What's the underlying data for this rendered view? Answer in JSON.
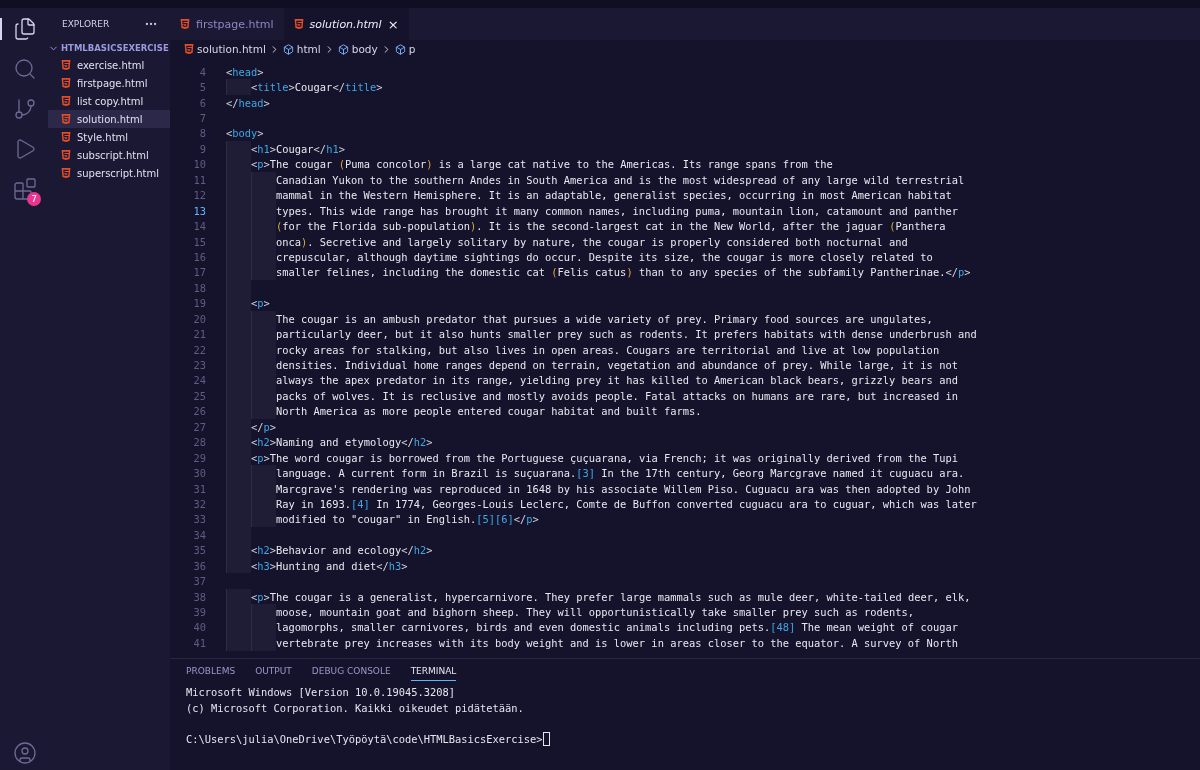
{
  "activity_bar": {
    "items": [
      {
        "kind": "files",
        "selected": true
      },
      {
        "kind": "search",
        "selected": false
      },
      {
        "kind": "source-control",
        "selected": false
      },
      {
        "kind": "run",
        "selected": false
      },
      {
        "kind": "extensions",
        "selected": false,
        "badge": "7"
      }
    ],
    "account": {
      "kind": "account"
    }
  },
  "sidebar": {
    "title": "EXPLORER",
    "folder": {
      "name": "HTMLBASICSEXERCISE",
      "expanded": true,
      "files": [
        {
          "name": "exercise.html",
          "selected": false
        },
        {
          "name": "firstpage.html",
          "selected": false
        },
        {
          "name": "list copy.html",
          "selected": false
        },
        {
          "name": "solution.html",
          "selected": true
        },
        {
          "name": "Style.html",
          "selected": false
        },
        {
          "name": "subscript.html",
          "selected": false
        },
        {
          "name": "superscript.html",
          "selected": false
        }
      ]
    }
  },
  "tabs": [
    {
      "label": "firstpage.html",
      "selected": false
    },
    {
      "label": "solution.html",
      "selected": true,
      "close": "×"
    }
  ],
  "breadcrumbs": [
    {
      "label": "solution.html",
      "kind": "file"
    },
    {
      "label": "html",
      "kind": "element"
    },
    {
      "label": "body",
      "kind": "element"
    },
    {
      "label": "p",
      "kind": "element"
    }
  ],
  "editor": {
    "lines": [
      {
        "num": "4",
        "current": false,
        "tokens": [
          {
            "kind": "punct",
            "text": "<"
          },
          {
            "kind": "tag",
            "text": "head"
          },
          {
            "kind": "punct",
            "text": ">"
          }
        ]
      },
      {
        "num": "5",
        "current": false,
        "tokens": [
          {
            "kind": "indent"
          },
          {
            "kind": "punct",
            "text": "<"
          },
          {
            "kind": "tag",
            "text": "title"
          },
          {
            "kind": "punct",
            "text": ">"
          },
          {
            "kind": "text",
            "text": "Cougar"
          },
          {
            "kind": "punct",
            "text": "</"
          },
          {
            "kind": "tag",
            "text": "title"
          },
          {
            "kind": "punct",
            "text": ">"
          }
        ]
      },
      {
        "num": "6",
        "current": false,
        "tokens": [
          {
            "kind": "punct",
            "text": "</"
          },
          {
            "kind": "tag",
            "text": "head"
          },
          {
            "kind": "punct",
            "text": ">"
          }
        ]
      },
      {
        "num": "7",
        "current": false
      },
      {
        "num": "8",
        "current": false,
        "tokens": [
          {
            "kind": "punct",
            "text": "<"
          },
          {
            "kind": "tag",
            "text": "body"
          },
          {
            "kind": "punct",
            "text": ">"
          }
        ]
      },
      {
        "num": "9",
        "current": false,
        "tokens": [
          {
            "kind": "indent"
          },
          {
            "kind": "punct",
            "text": "<"
          },
          {
            "kind": "tag",
            "text": "h1"
          },
          {
            "kind": "punct",
            "text": ">"
          },
          {
            "kind": "text",
            "text": "Cougar"
          },
          {
            "kind": "punct",
            "text": "</"
          },
          {
            "kind": "tag",
            "text": "h1"
          },
          {
            "kind": "punct",
            "text": ">"
          }
        ]
      },
      {
        "num": "10",
        "current": false,
        "tokens": [
          {
            "kind": "indent"
          },
          {
            "kind": "punct",
            "text": "<"
          },
          {
            "kind": "tag",
            "text": "p"
          },
          {
            "kind": "punct",
            "text": ">"
          },
          {
            "kind": "text",
            "text": "The cougar "
          },
          {
            "kind": "paren",
            "text": "("
          },
          {
            "kind": "text",
            "text": "Puma concolor"
          },
          {
            "kind": "paren",
            "text": ")"
          },
          {
            "kind": "text",
            "text": " is a large cat native to the Americas. Its range spans from the"
          }
        ]
      },
      {
        "num": "11",
        "current": false,
        "tokens": [
          {
            "kind": "indent"
          },
          {
            "kind": "indent"
          },
          {
            "kind": "text",
            "text": "Canadian Yukon to the southern Andes in South America and is the most widespread of any large wild terrestrial"
          }
        ]
      },
      {
        "num": "12",
        "current": false,
        "tokens": [
          {
            "kind": "indent"
          },
          {
            "kind": "indent"
          },
          {
            "kind": "text",
            "text": "mammal in the Western Hemisphere. It is an adaptable, generalist species, occurring in most American habitat"
          }
        ]
      },
      {
        "num": "13",
        "current": true,
        "tokens": [
          {
            "kind": "indent"
          },
          {
            "kind": "indent"
          },
          {
            "kind": "text",
            "text": "types. This wide range has brought it many common names, including puma, mountain lion, catamount and panther"
          }
        ]
      },
      {
        "num": "14",
        "current": false,
        "tokens": [
          {
            "kind": "indent"
          },
          {
            "kind": "indent"
          },
          {
            "kind": "paren",
            "text": "("
          },
          {
            "kind": "text",
            "text": "for the Florida sub-population"
          },
          {
            "kind": "paren",
            "text": ")"
          },
          {
            "kind": "text",
            "text": ". It is the second-largest cat in the New World, after the jaguar "
          },
          {
            "kind": "paren",
            "text": "("
          },
          {
            "kind": "text",
            "text": "Panthera"
          }
        ]
      },
      {
        "num": "15",
        "current": false,
        "tokens": [
          {
            "kind": "indent"
          },
          {
            "kind": "indent"
          },
          {
            "kind": "text",
            "text": "onca"
          },
          {
            "kind": "paren",
            "text": ")"
          },
          {
            "kind": "text",
            "text": ". Secretive and largely solitary by nature, the cougar is properly considered both nocturnal and"
          }
        ]
      },
      {
        "num": "16",
        "current": false,
        "tokens": [
          {
            "kind": "indent"
          },
          {
            "kind": "indent"
          },
          {
            "kind": "text",
            "text": "crepuscular, although daytime sightings do occur. Despite its size, the cougar is more closely related to"
          }
        ]
      },
      {
        "num": "17",
        "current": false,
        "tokens": [
          {
            "kind": "indent"
          },
          {
            "kind": "indent"
          },
          {
            "kind": "text",
            "text": "smaller felines, including the domestic cat "
          },
          {
            "kind": "paren",
            "text": "("
          },
          {
            "kind": "text",
            "text": "Felis catus"
          },
          {
            "kind": "paren",
            "text": ")"
          },
          {
            "kind": "text",
            "text": " than to any species of the subfamily Pantherinae."
          },
          {
            "kind": "punct",
            "text": "</"
          },
          {
            "kind": "tag",
            "text": "p"
          },
          {
            "kind": "punct",
            "text": ">"
          }
        ]
      },
      {
        "num": "18",
        "current": false,
        "tokens": [
          {
            "kind": "indent"
          }
        ]
      },
      {
        "num": "19",
        "current": false,
        "tokens": [
          {
            "kind": "indent"
          },
          {
            "kind": "punct",
            "text": "<"
          },
          {
            "kind": "tag",
            "text": "p"
          },
          {
            "kind": "punct",
            "text": ">"
          }
        ]
      },
      {
        "num": "20",
        "current": false,
        "tokens": [
          {
            "kind": "indent"
          },
          {
            "kind": "indent"
          },
          {
            "kind": "text",
            "text": "The cougar is an ambush predator that pursues a wide variety of prey. Primary food sources are ungulates,"
          }
        ]
      },
      {
        "num": "21",
        "current": false,
        "tokens": [
          {
            "kind": "indent"
          },
          {
            "kind": "indent"
          },
          {
            "kind": "text",
            "text": "particularly deer, but it also hunts smaller prey such as rodents. It prefers habitats with dense underbrush and"
          }
        ]
      },
      {
        "num": "22",
        "current": false,
        "tokens": [
          {
            "kind": "indent"
          },
          {
            "kind": "indent"
          },
          {
            "kind": "text",
            "text": "rocky areas for stalking, but also lives in open areas. Cougars are territorial and live at low population"
          }
        ]
      },
      {
        "num": "23",
        "current": false,
        "tokens": [
          {
            "kind": "indent"
          },
          {
            "kind": "indent"
          },
          {
            "kind": "text",
            "text": "densities. Individual home ranges depend on terrain, vegetation and abundance of prey. While large, it is not"
          }
        ]
      },
      {
        "num": "24",
        "current": false,
        "tokens": [
          {
            "kind": "indent"
          },
          {
            "kind": "indent"
          },
          {
            "kind": "text",
            "text": "always the apex predator in its range, yielding prey it has killed to American black bears, grizzly bears and"
          }
        ]
      },
      {
        "num": "25",
        "current": false,
        "tokens": [
          {
            "kind": "indent"
          },
          {
            "kind": "indent"
          },
          {
            "kind": "text",
            "text": "packs of wolves. It is reclusive and mostly avoids people. Fatal attacks on humans are rare, but increased in"
          }
        ]
      },
      {
        "num": "26",
        "current": false,
        "tokens": [
          {
            "kind": "indent"
          },
          {
            "kind": "indent"
          },
          {
            "kind": "text",
            "text": "North America as more people entered cougar habitat and built farms."
          }
        ]
      },
      {
        "num": "27",
        "current": false,
        "tokens": [
          {
            "kind": "indent"
          },
          {
            "kind": "punct",
            "text": "</"
          },
          {
            "kind": "tag",
            "text": "p"
          },
          {
            "kind": "punct",
            "text": ">"
          }
        ]
      },
      {
        "num": "28",
        "current": false,
        "tokens": [
          {
            "kind": "indent"
          },
          {
            "kind": "punct",
            "text": "<"
          },
          {
            "kind": "tag",
            "text": "h2"
          },
          {
            "kind": "punct",
            "text": ">"
          },
          {
            "kind": "text",
            "text": "Naming and etymology"
          },
          {
            "kind": "punct",
            "text": "</"
          },
          {
            "kind": "tag",
            "text": "h2"
          },
          {
            "kind": "punct",
            "text": ">"
          }
        ]
      },
      {
        "num": "29",
        "current": false,
        "tokens": [
          {
            "kind": "indent"
          },
          {
            "kind": "punct",
            "text": "<"
          },
          {
            "kind": "tag",
            "text": "p"
          },
          {
            "kind": "punct",
            "text": ">"
          },
          {
            "kind": "text",
            "text": "The word cougar is borrowed from the Portuguese çuçuarana, via French; it was originally derived from the Tupi"
          }
        ]
      },
      {
        "num": "30",
        "current": false,
        "tokens": [
          {
            "kind": "indent"
          },
          {
            "kind": "indent"
          },
          {
            "kind": "text",
            "text": "language. A current form in Brazil is suçuarana."
          },
          {
            "kind": "ref",
            "text": "[3]"
          },
          {
            "kind": "text",
            "text": " In the 17th century, Georg Marcgrave named it cuguacu ara."
          }
        ]
      },
      {
        "num": "31",
        "current": false,
        "tokens": [
          {
            "kind": "indent"
          },
          {
            "kind": "indent"
          },
          {
            "kind": "text",
            "text": "Marcgrave's rendering was reproduced in 1648 by his associate Willem Piso. Cuguacu ara was then adopted by John"
          }
        ]
      },
      {
        "num": "32",
        "current": false,
        "tokens": [
          {
            "kind": "indent"
          },
          {
            "kind": "indent"
          },
          {
            "kind": "text",
            "text": "Ray in 1693."
          },
          {
            "kind": "ref",
            "text": "[4]"
          },
          {
            "kind": "text",
            "text": " In 1774, Georges-Louis Leclerc, Comte de Buffon converted cuguacu ara to cuguar, which was later"
          }
        ]
      },
      {
        "num": "33",
        "current": false,
        "tokens": [
          {
            "kind": "indent"
          },
          {
            "kind": "indent"
          },
          {
            "kind": "text",
            "text": "modified to \"cougar\" in English."
          },
          {
            "kind": "ref",
            "text": "[5]"
          },
          {
            "kind": "ref",
            "text": "[6]"
          },
          {
            "kind": "punct",
            "text": "</"
          },
          {
            "kind": "tag",
            "text": "p"
          },
          {
            "kind": "punct",
            "text": ">"
          }
        ]
      },
      {
        "num": "34",
        "current": false,
        "tokens": [
          {
            "kind": "indent"
          }
        ]
      },
      {
        "num": "35",
        "current": false,
        "tokens": [
          {
            "kind": "indent"
          },
          {
            "kind": "punct",
            "text": "<"
          },
          {
            "kind": "tag",
            "text": "h2"
          },
          {
            "kind": "punct",
            "text": ">"
          },
          {
            "kind": "text",
            "text": "Behavior and ecology"
          },
          {
            "kind": "punct",
            "text": "</"
          },
          {
            "kind": "tag",
            "text": "h2"
          },
          {
            "kind": "punct",
            "text": ">"
          }
        ]
      },
      {
        "num": "36",
        "current": false,
        "tokens": [
          {
            "kind": "indent"
          },
          {
            "kind": "punct",
            "text": "<"
          },
          {
            "kind": "tag",
            "text": "h3"
          },
          {
            "kind": "punct",
            "text": ">"
          },
          {
            "kind": "text",
            "text": "Hunting and diet"
          },
          {
            "kind": "punct",
            "text": "</"
          },
          {
            "kind": "tag",
            "text": "h3"
          },
          {
            "kind": "punct",
            "text": ">"
          }
        ]
      },
      {
        "num": "37",
        "current": false
      },
      {
        "num": "38",
        "current": false,
        "tokens": [
          {
            "kind": "indent"
          },
          {
            "kind": "punct",
            "text": "<"
          },
          {
            "kind": "tag",
            "text": "p"
          },
          {
            "kind": "punct",
            "text": ">"
          },
          {
            "kind": "text",
            "text": "The cougar is a generalist, hypercarnivore. They prefer large mammals such as mule deer, white-tailed deer, elk,"
          }
        ]
      },
      {
        "num": "39",
        "current": false,
        "tokens": [
          {
            "kind": "indent"
          },
          {
            "kind": "indent"
          },
          {
            "kind": "text",
            "text": "moose, mountain goat and bighorn sheep. They will opportunistically take smaller prey such as rodents,"
          }
        ]
      },
      {
        "num": "40",
        "current": false,
        "tokens": [
          {
            "kind": "indent"
          },
          {
            "kind": "indent"
          },
          {
            "kind": "text",
            "text": "lagomorphs, smaller carnivores, birds and even domestic animals including pets."
          },
          {
            "kind": "ref",
            "text": "[48]"
          },
          {
            "kind": "text",
            "text": " The mean weight of cougar"
          }
        ]
      },
      {
        "num": "41",
        "current": false,
        "tokens": [
          {
            "kind": "indent"
          },
          {
            "kind": "indent"
          },
          {
            "kind": "text",
            "text": "vertebrate prey increases with its body weight and is lower in areas closer to the equator. A survey of North"
          }
        ]
      }
    ]
  },
  "panel": {
    "tabs": [
      {
        "label": "PROBLEMS",
        "selected": false
      },
      {
        "label": "OUTPUT",
        "selected": false
      },
      {
        "label": "DEBUG CONSOLE",
        "selected": false
      },
      {
        "label": "TERMINAL",
        "selected": true
      }
    ],
    "terminal": {
      "lines": [
        "Microsoft Windows [Version 10.0.19045.3208]",
        "(c) Microsoft Corporation. Kaikki oikeudet pidätetään."
      ],
      "prompt": "C:\\Users\\julia\\OneDrive\\Työpöytä\\code\\HTMLBasicsExercise>"
    }
  }
}
